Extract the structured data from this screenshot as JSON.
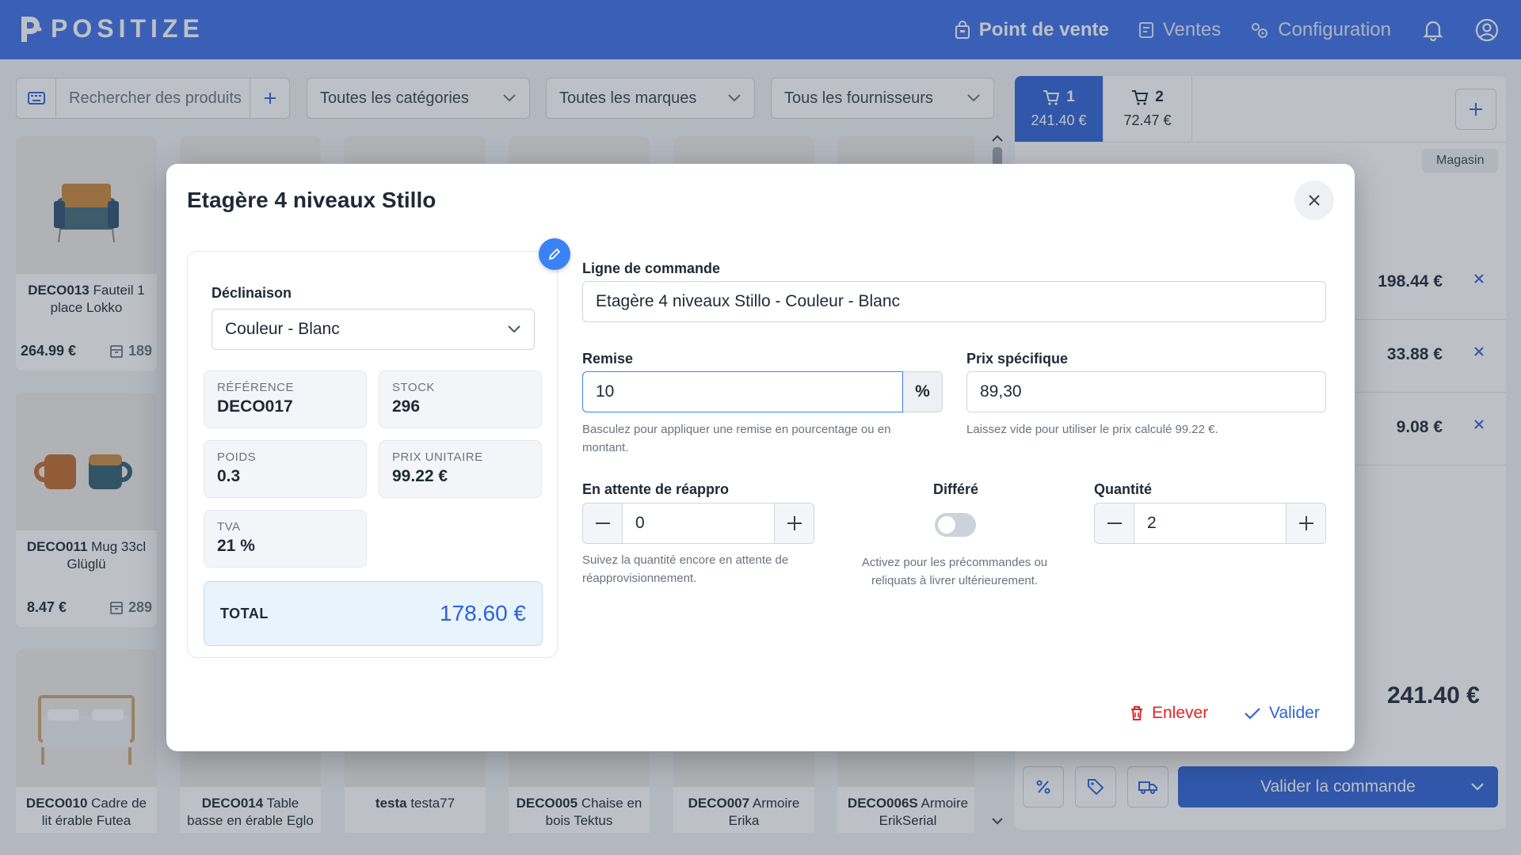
{
  "app": {
    "logo_text": "POSITIZE",
    "nav": {
      "pos": "Point de vente",
      "sales": "Ventes",
      "config": "Configuration"
    }
  },
  "filters": {
    "search_placeholder": "Rechercher des produits",
    "categories": "Toutes les catégories",
    "brands": "Toutes les marques",
    "suppliers": "Tous les fournisseurs"
  },
  "products": [
    {
      "ref": "DECO013",
      "name": "Fauteil 1 place Lokko",
      "price": "264.99 €",
      "stock": "189"
    },
    {
      "ref": "DECO011",
      "name": "Mug 33cl Glüglü",
      "price": "8.47 €",
      "stock": "289"
    },
    {
      "ref": "DECO010",
      "name": "Cadre de lit érable Futea"
    },
    {
      "ref": "DECO014",
      "name": "Table basse en érable Eglo"
    },
    {
      "ref": "testa",
      "name": "testa77"
    },
    {
      "ref": "DECO005",
      "name": "Chaise en bois Tektus"
    },
    {
      "ref": "DECO007",
      "name": "Armoire Erika"
    },
    {
      "ref": "DECO006S",
      "name": "Armoire ErikSerial"
    }
  ],
  "cart": {
    "tabs": [
      {
        "num": "1",
        "amount": "241.40 €"
      },
      {
        "num": "2",
        "amount": "72.47 €"
      }
    ],
    "store_badge": "Magasin",
    "lines": [
      "198.44 €",
      "33.88 €",
      "9.08 €"
    ],
    "total": "241.40 €",
    "validate_label": "Valider la commande"
  },
  "modal": {
    "title": "Etagère 4 niveaux Stillo",
    "variant_label": "Déclinaison",
    "variant_value": "Couleur - Blanc",
    "stats": {
      "reference_k": "RÉFÉRENCE",
      "reference_v": "DECO017",
      "stock_k": "STOCK",
      "stock_v": "296",
      "weight_k": "POIDS",
      "weight_v": "0.3",
      "unit_price_k": "PRIX UNITAIRE",
      "unit_price_v": "99.22 €",
      "vat_k": "TVA",
      "vat_v": "21 %"
    },
    "total_label": "TOTAL",
    "total_value": "178.60 €",
    "order_line_label": "Ligne de commande",
    "order_line_value": "Etagère 4 niveaux Stillo - Couleur - Blanc",
    "discount_label": "Remise",
    "discount_value": "10",
    "discount_unit": "%",
    "discount_help": "Basculez pour appliquer une remise en pourcentage ou en montant.",
    "specific_price_label": "Prix spécifique",
    "specific_price_value": "89,30",
    "specific_price_help": "Laissez vide pour utiliser le prix calculé 99.22 €.",
    "backorder_label": "En attente de réappro",
    "backorder_value": "0",
    "backorder_help": "Suivez la quantité encore en attente de réapprovisionnement.",
    "deferred_label": "Différé",
    "deferred_help": "Activez pour les précommandes ou reliquats à livrer ultérieurement.",
    "quantity_label": "Quantité",
    "quantity_value": "2",
    "remove_label": "Enlever",
    "validate_label": "Valider"
  }
}
